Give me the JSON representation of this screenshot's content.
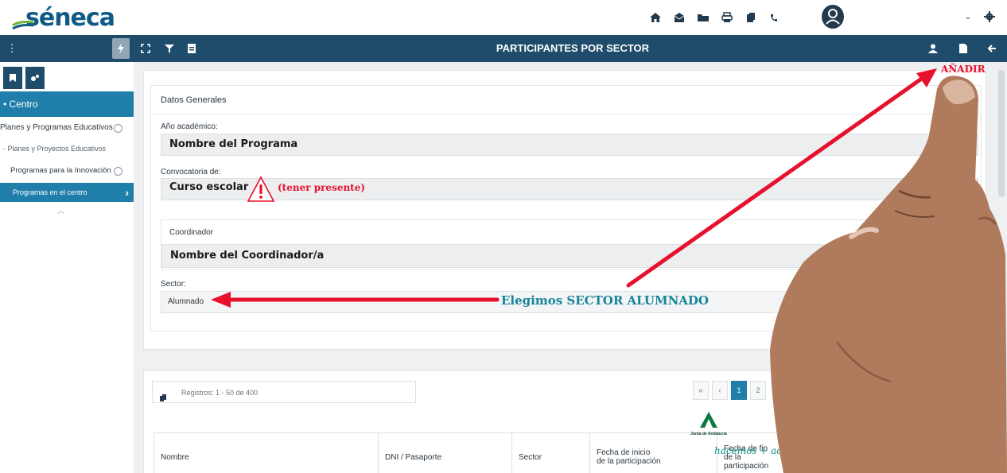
{
  "app": {
    "logo_text": "séneca"
  },
  "navbar": {
    "title": "PARTICIPANTES POR SECTOR"
  },
  "sidebar": {
    "center_label": "• Centro",
    "items": [
      {
        "label": "Planes y Programas Educativos"
      },
      {
        "label": "- Planes y Proyectos Educativos"
      },
      {
        "label": "Programas para la Innovación"
      },
      {
        "label": "Programas en el centro"
      }
    ]
  },
  "form": {
    "section_title": "Datos Generales",
    "year_label": "Año académico:",
    "year_value": "Nombre del Programa",
    "call_label": "Convocatoria de:",
    "call_value": "Curso escolar",
    "call_note": "(tener presente)",
    "coordinator_label": "Coordinador",
    "coordinator_value": "Nombre del Coordinador/a",
    "sector_label": "Sector:",
    "sector_value": "Alumnado"
  },
  "annotations": {
    "choose_sector": "Elegimos SECTOR ALUMNADO",
    "add": "AÑADIR"
  },
  "records": {
    "text": "Registros: 1 - 50 de 400",
    "pages": [
      "«",
      "‹",
      "1",
      "2"
    ],
    "active_page": "1"
  },
  "table": {
    "headers": [
      "Nombre",
      "DNI / Pasaporte",
      "Sector",
      "Fecha de inicio de la participación",
      "Fecha de fin de la participación"
    ]
  },
  "footer_logo": {
    "junta": "Junta de Andalucía",
    "slogan": "hacemos + acompañamos"
  },
  "colors": {
    "navbar": "#1f4c6b",
    "accent": "#1f7faa",
    "arrow_red": "#e8112d",
    "teal_text": "#17849a",
    "skin": "#b07a5c"
  },
  "icons": {
    "top": [
      "home-icon",
      "mail-icon",
      "folder-icon",
      "print-icon",
      "copy-icon",
      "phone-icon"
    ],
    "user": "user-icon",
    "settings": "gear-icon"
  }
}
